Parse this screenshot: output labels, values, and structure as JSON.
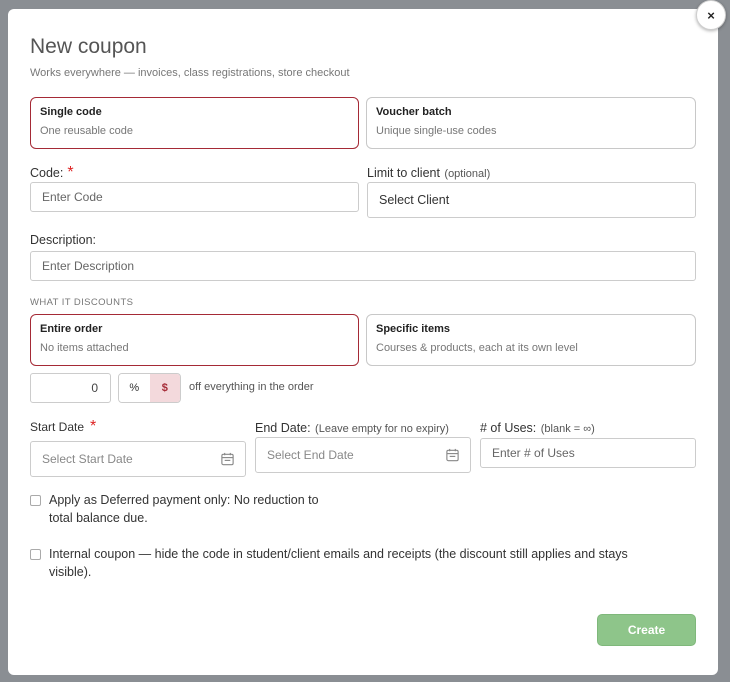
{
  "modal": {
    "title": "New coupon",
    "subtitle": "Works everywhere — invoices, class registrations, store checkout",
    "close_label": "×"
  },
  "code_type": {
    "options": [
      {
        "title": "Single code",
        "desc": "One reusable code",
        "selected": true
      },
      {
        "title": "Voucher batch",
        "desc": "Unique single-use codes",
        "selected": false
      }
    ]
  },
  "code": {
    "label": "Code:",
    "required_mark": "*",
    "placeholder": "Enter Code"
  },
  "client": {
    "label": "Limit to client",
    "hint": "(optional)",
    "value": "Select Client"
  },
  "description": {
    "label": "Description:",
    "placeholder": "Enter Description"
  },
  "discount_scope": {
    "section_label": "WHAT IT DISCOUNTS",
    "options": [
      {
        "title": "Entire order",
        "desc": "No items attached",
        "selected": true
      },
      {
        "title": "Specific items",
        "desc": "Courses & products, each at its own level",
        "selected": false
      }
    ]
  },
  "amount": {
    "value": "0",
    "unit_percent": "%",
    "unit_dollar": "$",
    "selected_unit": "$",
    "suffix": "off everything in the order"
  },
  "start_date": {
    "label": "Start Date",
    "required_mark": "*",
    "placeholder": "Select Start Date"
  },
  "end_date": {
    "label": "End Date:",
    "hint": "(Leave empty for no expiry)",
    "placeholder": "Select End Date"
  },
  "uses": {
    "label": "# of Uses:",
    "hint": "(blank = ∞)",
    "placeholder": "Enter # of Uses"
  },
  "checkboxes": {
    "deferred": {
      "checked": false,
      "line1": "Apply as Deferred payment only: No reduction to",
      "line2": "total balance due."
    },
    "internal": {
      "checked": false,
      "line1": "Internal coupon — hide the code in student/client emails and receipts (the discount still applies and stays",
      "line2": "visible)."
    }
  },
  "actions": {
    "create_label": "Create"
  },
  "colors": {
    "accent": "#a52a36",
    "create_bg": "#8ec58a",
    "required": "#dd2222"
  },
  "icons": {
    "calendar": "calendar-icon",
    "close": "close-icon"
  }
}
